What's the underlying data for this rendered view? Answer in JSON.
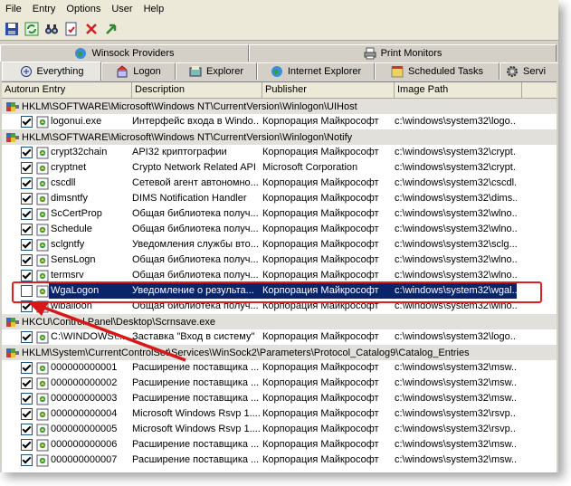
{
  "menu": [
    "File",
    "Entry",
    "Options",
    "User",
    "Help"
  ],
  "toolbar": [
    "save-icon",
    "refresh-icon",
    "find-icon",
    "properties-icon",
    "delete-icon",
    "jump-icon"
  ],
  "tabs_top": [
    "Winsock Providers",
    "Print Monitors"
  ],
  "tabs_bottom": [
    "Everything",
    "Logon",
    "Explorer",
    "Internet Explorer",
    "Scheduled Tasks",
    "Servi"
  ],
  "columns": [
    "Autorun Entry",
    "Description",
    "Publisher",
    "Image Path"
  ],
  "groups": [
    {
      "key": "HKLM\\SOFTWARE\\Microsoft\\Windows NT\\CurrentVersion\\Winlogon\\UIHost",
      "rows": [
        {
          "checked": true,
          "name": "logonui.exe",
          "desc": "Интерфейс входа в Windo...",
          "pub": "Корпорация Майкрософт",
          "path": "c:\\windows\\system32\\logo..."
        }
      ]
    },
    {
      "key": "HKLM\\SOFTWARE\\Microsoft\\Windows NT\\CurrentVersion\\Winlogon\\Notify",
      "rows": [
        {
          "checked": true,
          "name": "crypt32chain",
          "desc": "API32 криптографии",
          "pub": "Корпорация Майкрософт",
          "path": "c:\\windows\\system32\\crypt..."
        },
        {
          "checked": true,
          "name": "cryptnet",
          "desc": "Crypto Network Related API",
          "pub": "Microsoft Corporation",
          "path": "c:\\windows\\system32\\crypt..."
        },
        {
          "checked": true,
          "name": "cscdll",
          "desc": "Сетевой агент автономно...",
          "pub": "Корпорация Майкрософт",
          "path": "c:\\windows\\system32\\cscdl..."
        },
        {
          "checked": true,
          "name": "dimsntfy",
          "desc": "DIMS Notification Handler",
          "pub": "Корпорация Майкрософт",
          "path": "c:\\windows\\system32\\dims..."
        },
        {
          "checked": true,
          "name": "ScCertProp",
          "desc": "Общая библиотека получ...",
          "pub": "Корпорация Майкрософт",
          "path": "c:\\windows\\system32\\wlno..."
        },
        {
          "checked": true,
          "name": "Schedule",
          "desc": "Общая библиотека получ...",
          "pub": "Корпорация Майкрософт",
          "path": "c:\\windows\\system32\\wlno..."
        },
        {
          "checked": true,
          "name": "sclgntfy",
          "desc": "Уведомления службы вто...",
          "pub": "Корпорация Майкрософт",
          "path": "c:\\windows\\system32\\sclg..."
        },
        {
          "checked": true,
          "name": "SensLogn",
          "desc": "Общая библиотека получ...",
          "pub": "Корпорация Майкрософт",
          "path": "c:\\windows\\system32\\wlno..."
        },
        {
          "checked": true,
          "name": "termsrv",
          "desc": "Общая библиотека получ...",
          "pub": "Корпорация Майкрософт",
          "path": "c:\\windows\\system32\\wlno..."
        },
        {
          "checked": false,
          "selected": true,
          "name": "WgaLogon",
          "desc": "Уведомление о результа...",
          "pub": "Корпорация Майкрософт",
          "path": "c:\\windows\\system32\\wgal..."
        },
        {
          "checked": true,
          "name": "wlballoon",
          "desc": "Общая библиотека получ...",
          "pub": "Корпорация Майкрософт",
          "path": "c:\\windows\\system32\\wlno..."
        }
      ]
    },
    {
      "key": "HKCU\\Control Panel\\Desktop\\Scrnsave.exe",
      "rows": [
        {
          "checked": true,
          "name": "C:\\WINDOWS\\...",
          "desc": "Заставка \"Вход в систему\"",
          "pub": "Корпорация Майкрософт",
          "path": "c:\\windows\\system32\\logo..."
        }
      ]
    },
    {
      "key": "HKLM\\System\\CurrentControlSet\\Services\\WinSock2\\Parameters\\Protocol_Catalog9\\Catalog_Entries",
      "rows": [
        {
          "checked": true,
          "name": "000000000001",
          "desc": "Расширение поставщика ...",
          "pub": "Корпорация Майкрософт",
          "path": "c:\\windows\\system32\\msw..."
        },
        {
          "checked": true,
          "name": "000000000002",
          "desc": "Расширение поставщика ...",
          "pub": "Корпорация Майкрософт",
          "path": "c:\\windows\\system32\\msw..."
        },
        {
          "checked": true,
          "name": "000000000003",
          "desc": "Расширение поставщика ...",
          "pub": "Корпорация Майкрософт",
          "path": "c:\\windows\\system32\\msw..."
        },
        {
          "checked": true,
          "name": "000000000004",
          "desc": "Microsoft Windows Rsvp 1....",
          "pub": "Корпорация Майкрософт",
          "path": "c:\\windows\\system32\\rsvp..."
        },
        {
          "checked": true,
          "name": "000000000005",
          "desc": "Microsoft Windows Rsvp 1....",
          "pub": "Корпорация Майкрософт",
          "path": "c:\\windows\\system32\\rsvp..."
        },
        {
          "checked": true,
          "name": "000000000006",
          "desc": "Расширение поставщика ...",
          "pub": "Корпорация Майкрософт",
          "path": "c:\\windows\\system32\\msw..."
        },
        {
          "checked": true,
          "name": "000000000007",
          "desc": "Расширение поставщика ...",
          "pub": "Корпорация Майкрософт",
          "path": "c:\\windows\\system32\\msw..."
        }
      ]
    }
  ],
  "colors": {
    "selection": "#0a246a",
    "highlight_box": "#e02020",
    "arrow": "#d81818"
  }
}
